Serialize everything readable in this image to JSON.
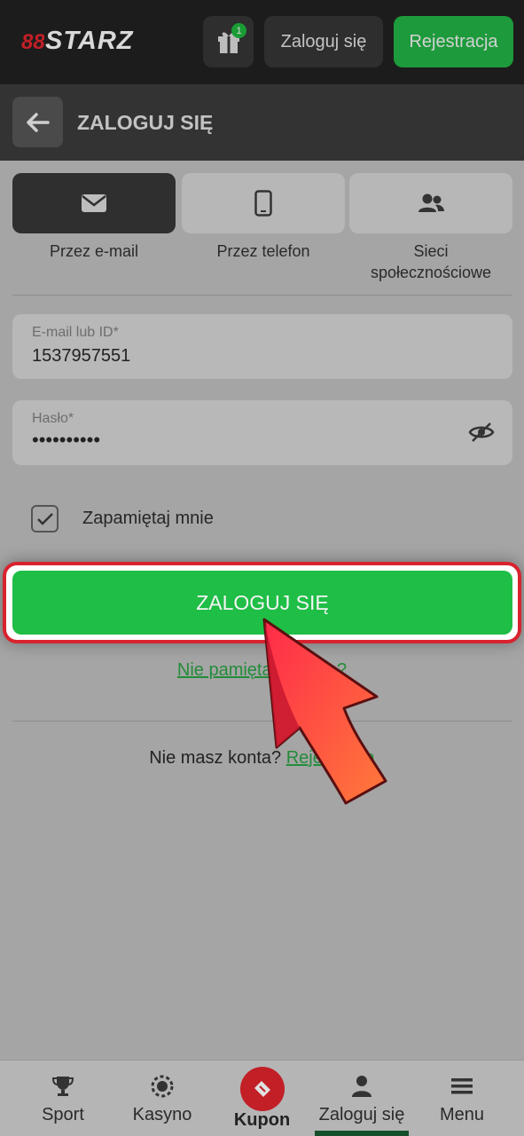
{
  "header": {
    "logo_text": "STARZ",
    "gift_badge": "1",
    "login_label": "Zaloguj się",
    "register_label": "Rejestracja"
  },
  "titlebar": {
    "title": "ZALOGUJ SIĘ"
  },
  "methods": [
    {
      "label": "Przez e-mail",
      "icon": "envelope-icon",
      "active": true
    },
    {
      "label": "Przez telefon",
      "icon": "phone-icon",
      "active": false
    },
    {
      "label_line1": "Sieci",
      "label_line2": "społecznościowe",
      "icon": "people-icon",
      "active": false
    }
  ],
  "form": {
    "email_label": "E-mail lub ID*",
    "email_value": "1537957551",
    "password_label": "Hasło*",
    "password_value": "••••••••••",
    "remember_label": "Zapamiętaj mnie",
    "remember_checked": true,
    "submit_label": "ZALOGUJ SIĘ",
    "forgot_label": "Nie pamiętasz hasła?",
    "no_account_text": "Nie masz konta?",
    "register_link": "Rejestracja"
  },
  "bottom_nav": {
    "items": [
      {
        "label": "Sport",
        "icon": "trophy-icon"
      },
      {
        "label": "Kasyno",
        "icon": "casino-chip-icon"
      },
      {
        "label": "Kupon",
        "icon": "ticket-icon"
      },
      {
        "label": "Zaloguj się",
        "icon": "user-icon",
        "active": true
      },
      {
        "label": "Menu",
        "icon": "hamburger-icon"
      }
    ]
  },
  "colors": {
    "accent_green": "#1fbe46",
    "highlight_red": "#d8232f",
    "brand_red": "#c21f27"
  }
}
